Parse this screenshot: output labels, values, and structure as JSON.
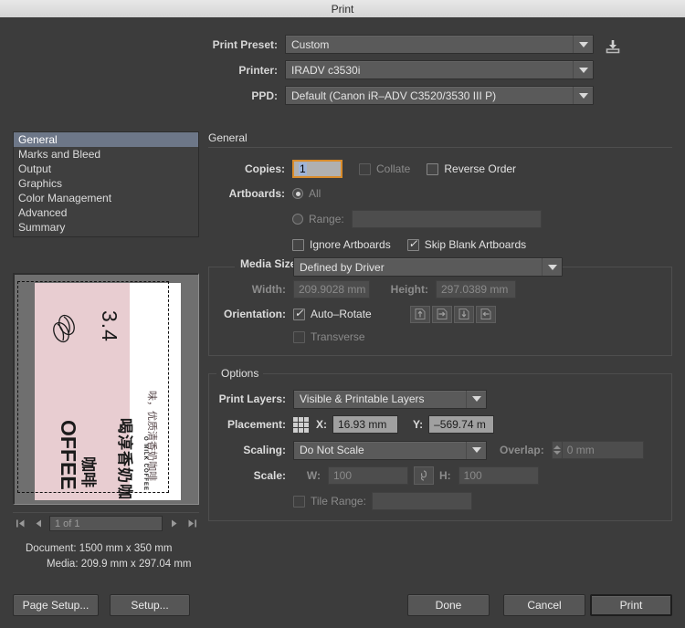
{
  "window": {
    "title": "Print"
  },
  "top": {
    "preset_label": "Print Preset:",
    "preset_value": "Custom",
    "printer_label": "Printer:",
    "printer_value": "IRADV c3530i",
    "ppd_label": "PPD:",
    "ppd_value": "Default (Canon iR–ADV C3520/3530 III P)",
    "save_preset_icon": "save-download-icon"
  },
  "sidebar": {
    "items": [
      {
        "label": "General",
        "selected": true
      },
      {
        "label": "Marks and Bleed",
        "selected": false
      },
      {
        "label": "Output",
        "selected": false
      },
      {
        "label": "Graphics",
        "selected": false
      },
      {
        "label": "Color Management",
        "selected": false
      },
      {
        "label": "Advanced",
        "selected": false
      },
      {
        "label": "Summary",
        "selected": false
      }
    ]
  },
  "preview": {
    "artwork": {
      "background_color": "#e8cdd1",
      "page_color": "#ffffff",
      "texts": [
        "3.4",
        "喝淳香奶咖啡",
        "OFFEE",
        "咖啡",
        "O MILK COFFEE"
      ],
      "icon": "coffee-bean-icon"
    },
    "pagenav": {
      "first": "⏮",
      "prev": "◀",
      "value": "1 of 1",
      "next": "▶",
      "last": "⏭"
    },
    "document_info": "Document: 1500 mm x 350 mm",
    "media_info": "Media: 209.9 mm x 297.04 mm"
  },
  "general": {
    "group_label": "General",
    "copies_label": "Copies:",
    "copies_value": "1",
    "collate_label": "Collate",
    "collate_checked": false,
    "reverse_order_label": "Reverse Order",
    "reverse_order_checked": false,
    "artboards_label": "Artboards:",
    "all_label": "All",
    "range_label": "Range:",
    "range_value": "",
    "ignore_artboards_label": "Ignore Artboards",
    "ignore_artboards_checked": false,
    "skip_blank_label": "Skip Blank Artboards",
    "skip_blank_checked": true
  },
  "media": {
    "media_size_label": "Media Size:",
    "media_size_value": "Defined by Driver",
    "width_label": "Width:",
    "width_value": "209.9028 mm",
    "height_label": "Height:",
    "height_value": "297.0389 mm",
    "orientation_label": "Orientation:",
    "auto_rotate_label": "Auto–Rotate",
    "auto_rotate_checked": true,
    "orientation_buttons": [
      "portrait-up-icon",
      "landscape-left-icon",
      "portrait-down-icon",
      "landscape-right-icon"
    ],
    "transverse_label": "Transverse",
    "transverse_checked": false
  },
  "options": {
    "group_label": "Options",
    "print_layers_label": "Print Layers:",
    "print_layers_value": "Visible & Printable Layers",
    "placement_label": "Placement:",
    "placement_icon": "placement-anchor-grid-icon",
    "x_label": "X:",
    "x_value": "16.93 mm",
    "y_label": "Y:",
    "y_value": "–569.74 m",
    "scaling_label": "Scaling:",
    "scaling_value": "Do Not Scale",
    "overlap_label": "Overlap:",
    "overlap_value": "0 mm",
    "scale_label": "Scale:",
    "w_label": "W:",
    "w_value": "100",
    "h_label": "H:",
    "h_value": "100",
    "link_icon": "link-chain-icon",
    "tile_range_label": "Tile Range:",
    "tile_range_value": "",
    "tile_range_checked": false
  },
  "footer": {
    "page_setup": "Page Setup...",
    "setup": "Setup...",
    "done": "Done",
    "cancel": "Cancel",
    "print": "Print"
  },
  "colors": {
    "window_bg": "#3c3c3c",
    "focus_accent": "#d98c2b",
    "selection_blue": "#6d7788",
    "artwork_pink": "#e8cdd1"
  }
}
